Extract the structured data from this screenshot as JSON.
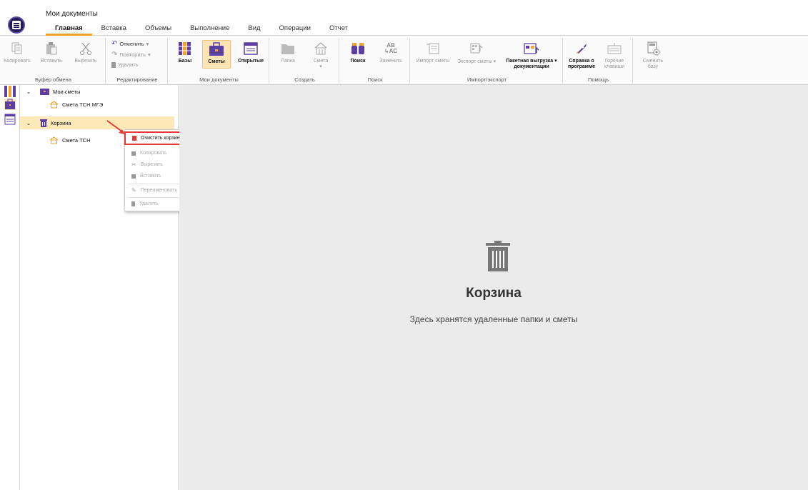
{
  "titlebar": {
    "title": "Мои документы",
    "tabs": [
      "Главная",
      "Вставка",
      "Объемы",
      "Выполнение",
      "Вид",
      "Операции",
      "Отчет"
    ],
    "active_tab": "Главная"
  },
  "ribbon": {
    "clipboard": {
      "copy": "Копировать",
      "paste": "Вставить",
      "cut": "Вырезать",
      "label": "Буфер обмена"
    },
    "editing": {
      "undo": "Отменить",
      "redo": "Повторить",
      "delete": "Удалить",
      "label": "Редактирование"
    },
    "mydocs": {
      "bases": "Базы",
      "estimates": "Сметы",
      "open": "Открытые",
      "label": "Мои документы"
    },
    "create": {
      "folder": "Папка",
      "estimate": "Смета",
      "label": "Создать"
    },
    "search": {
      "search": "Поиск",
      "replace": "Заменить",
      "label": "Поиск"
    },
    "importexport": {
      "import": "Импорт сметы",
      "export": "Экспорт сметы",
      "batch_line1": "Пакетная выгрузка",
      "batch_line2": "документации",
      "label": "Импорт/экспорт"
    },
    "help": {
      "about_line1": "Справка о",
      "about_line2": "программе",
      "hotkeys_line1": "Горячие",
      "hotkeys_line2": "клавиши",
      "label": "Помощь"
    },
    "base": {
      "line1": "Сменить",
      "line2": "базу"
    }
  },
  "tree": {
    "my_estimates": "Мои сметы",
    "estimate_mge": "Смета ТСН МГЭ",
    "trash": "Корзина",
    "estimate_tsn": "Смета ТСН"
  },
  "context_menu": {
    "clear_trash": "Очистить корзину",
    "copy": "Копировать",
    "cut": "Вырезать",
    "paste": "Вставить",
    "rename": "Переименовать",
    "delete": "Удалить"
  },
  "content": {
    "title": "Корзина",
    "subtitle": "Здесь хранятся удаленные папки и сметы"
  },
  "colors": {
    "accent": "#f2a32b",
    "purple": "#5b3fa3",
    "selection": "#fde9b8",
    "danger": "#e53935"
  }
}
